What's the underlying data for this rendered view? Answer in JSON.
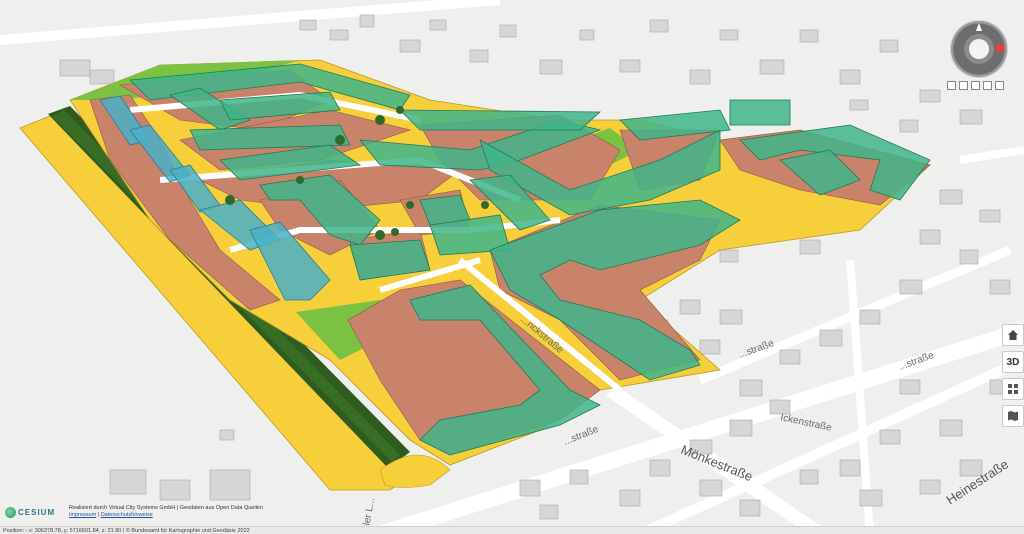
{
  "map": {
    "streets": {
      "moenkestrasse": "Mönkestraße",
      "heinestrasse": "Heinestraße",
      "muenckstrasse": "...nckstraße",
      "graf": "...ler L...",
      "side_a": "...straße",
      "side_b": "...straße",
      "side_c": "Ickenstraße",
      "side_d": "...straße"
    },
    "colors": {
      "residential_existing": "#dcdcdc",
      "planned_building": "#3fb58a",
      "planned_building_blue": "#4ab0c7",
      "plot_area": "#c8836a",
      "green_area": "#7cc242",
      "yellow_area": "#f6cf3a",
      "tree_row": "#2e5b1e",
      "road": "#ffffff"
    }
  },
  "controls": {
    "home_icon": "home-icon",
    "view_3d_label": "3D",
    "layers_icon": "grid-icon",
    "map_icon": "map-icon"
  },
  "attribution": {
    "logo_text": "CESIUM",
    "line1": "Realisiert durch Virtual City Systems GmbH  |  Geodaten aus Open Data Quellen",
    "impressum": "Impressum",
    "datenschutz": "Datenschutzhinweise"
  },
  "status": {
    "position_text": "Position: - x: 306378.78, y: 5716601.84, z: 21.80 | © Bundesamt für Kartographie und Geodäsie 2022"
  }
}
